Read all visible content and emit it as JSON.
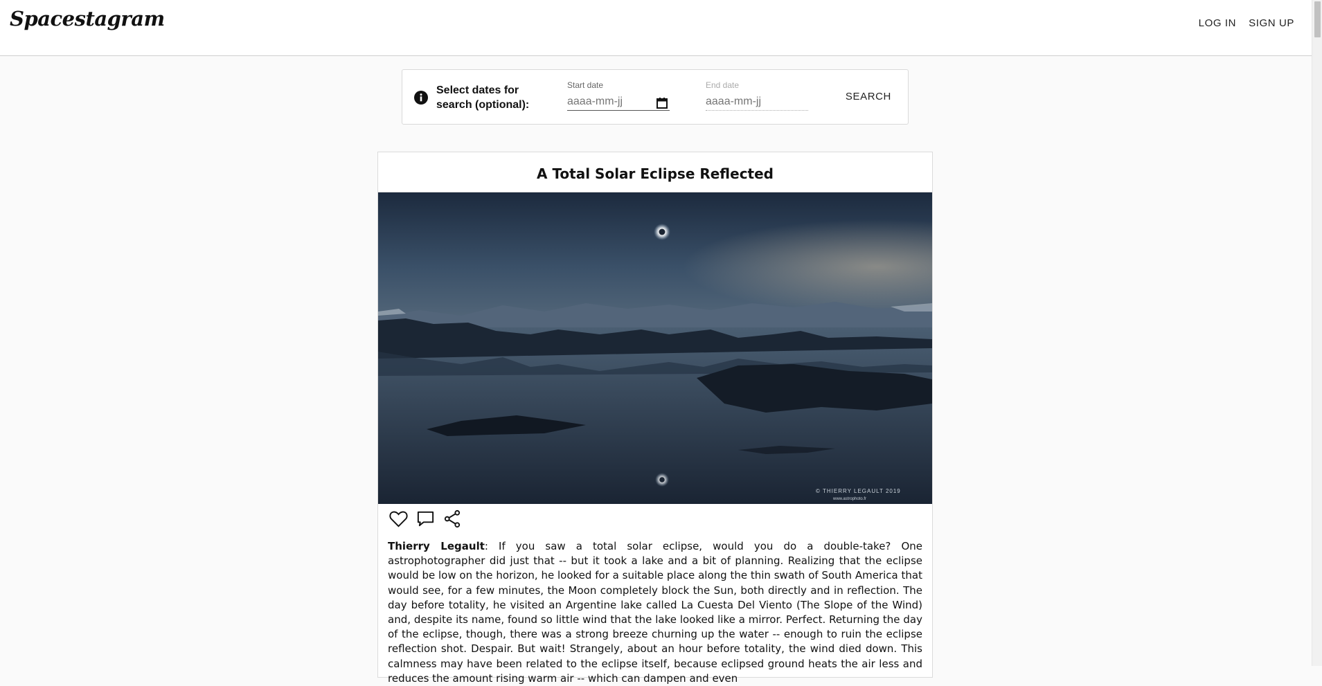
{
  "header": {
    "logo": "Spacestagram",
    "login": "LOG IN",
    "signup": "SIGN UP"
  },
  "search": {
    "label": "Select dates for search (optional):",
    "start_label": "Start date",
    "start_placeholder": "aaaa-mm-jj",
    "end_label": "End date",
    "end_placeholder": "aaaa-mm-jj",
    "button": "SEARCH"
  },
  "post": {
    "title": "A Total Solar Eclipse Reflected",
    "watermark_line1": "© THIERRY LEGAULT 2019",
    "watermark_line2": "www.astrophoto.fr",
    "author": "Thierry Legault",
    "description": ": If you saw a total solar eclipse, would you do a double-take? One astrophotographer did just that -- but it took a lake and a bit of planning. Realizing that the eclipse would be low on the horizon, he looked for a suitable place along the thin swath of South America that would see, for a few minutes, the Moon completely block the Sun, both directly and in reflection. The day before totality, he visited an Argentine lake called La Cuesta Del Viento (The Slope of the Wind) and, despite its name, found so little wind that the lake looked like a mirror. Perfect. Returning the day of the eclipse, though, there was a strong breeze churning up the water -- enough to ruin the eclipse reflection shot. Despair. But wait! Strangely, about an hour before totality, the wind died down. This calmness may have been related to the eclipse itself, because eclipsed ground heats the air less and reduces the amount rising warm air -- which can dampen and even"
  },
  "icons": {
    "info": "info-icon",
    "calendar": "calendar-icon",
    "like": "heart-icon",
    "comment": "comment-icon",
    "share": "share-icon"
  }
}
